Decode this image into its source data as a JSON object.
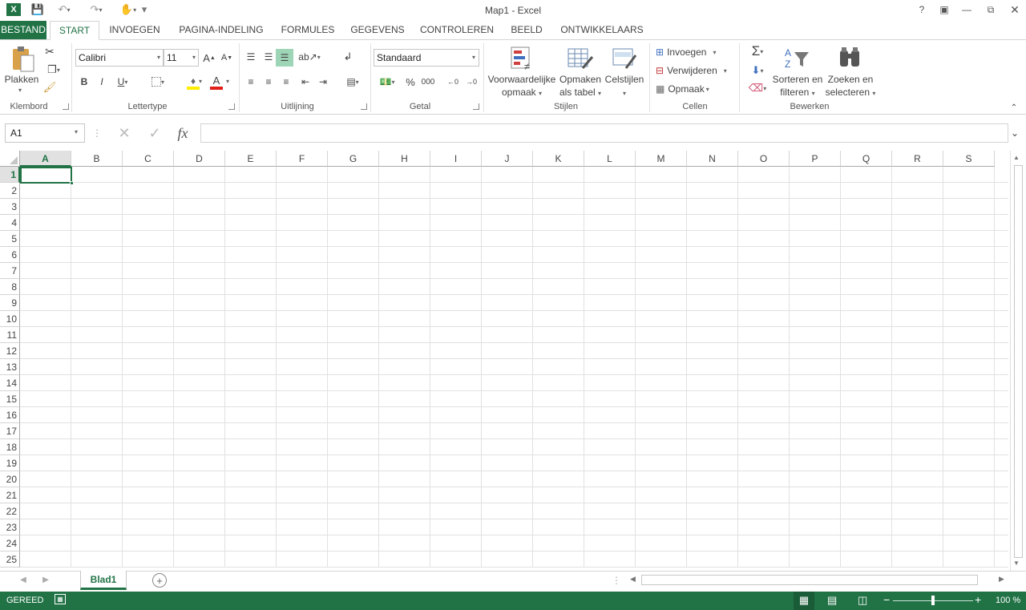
{
  "window": {
    "title": "Map1 - Excel"
  },
  "tabs": [
    "BESTAND",
    "START",
    "INVOEGEN",
    "PAGINA-INDELING",
    "FORMULES",
    "GEGEVENS",
    "CONTROLEREN",
    "BEELD",
    "ONTWIKKELAARS"
  ],
  "groups": {
    "klembord": {
      "label": "Klembord",
      "paste": "Plakken"
    },
    "lettertype": {
      "label": "Lettertype",
      "font": "Calibri",
      "size": "11",
      "bold": "B",
      "italic": "I",
      "underline": "U",
      "grow": "A",
      "shrink": "A"
    },
    "uitlijning": {
      "label": "Uitlijning"
    },
    "getal": {
      "label": "Getal",
      "format": "Standaard",
      "percent": "%",
      "thousands": "000"
    },
    "stijlen": {
      "label": "Stijlen",
      "cond1": "Voorwaardelijke",
      "cond2": "opmaak",
      "table1": "Opmaken",
      "table2": "als tabel",
      "cellstyles": "Celstijlen"
    },
    "cellen": {
      "label": "Cellen",
      "insert": "Invoegen",
      "delete": "Verwijderen",
      "format": "Opmaak"
    },
    "bewerken": {
      "label": "Bewerken",
      "sort1": "Sorteren en",
      "sort2": "filteren",
      "find1": "Zoeken en",
      "find2": "selecteren"
    }
  },
  "formula": {
    "namebox": "A1",
    "fx": "fx",
    "value": ""
  },
  "columns": [
    "A",
    "B",
    "C",
    "D",
    "E",
    "F",
    "G",
    "H",
    "I",
    "J",
    "K",
    "L",
    "M",
    "N",
    "O",
    "P",
    "Q",
    "R",
    "S"
  ],
  "rows": [
    "1",
    "2",
    "3",
    "4",
    "5",
    "6",
    "7",
    "8",
    "9",
    "10",
    "11",
    "12",
    "13",
    "14",
    "15",
    "16",
    "17",
    "18",
    "19",
    "20",
    "21",
    "22",
    "23",
    "24",
    "25"
  ],
  "sheet": {
    "tab": "Blad1"
  },
  "status": {
    "ready": "GEREED",
    "zoom": "100 %"
  },
  "colors": {
    "accent": "#217346"
  }
}
